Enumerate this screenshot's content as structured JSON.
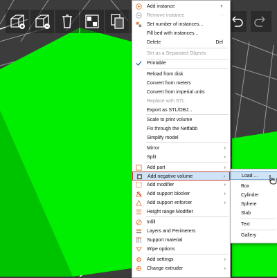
{
  "context_menu": {
    "items": [
      {
        "label": "Add instance",
        "shortcut": "+",
        "icon": "plus-circle-icon",
        "disabled": false
      },
      {
        "label": "Remove instance",
        "shortcut": "-",
        "icon": "minus-circle-icon",
        "disabled": true
      },
      {
        "label": "Set number of instances...",
        "icon": "instances-icon",
        "disabled": false
      },
      {
        "label": "Fill bed with instances...",
        "disabled": false
      },
      {
        "label": "Delete",
        "shortcut": "Del",
        "disabled": false
      },
      {
        "label": "Set as a Separated Objects",
        "disabled": true
      },
      {
        "label": "Printable",
        "checked": true,
        "disabled": false
      },
      {
        "label": "Reload from disk",
        "disabled": false
      },
      {
        "label": "Convert from meters",
        "disabled": false
      },
      {
        "label": "Convert from imperial units",
        "disabled": false
      },
      {
        "label": "Replace with STL",
        "disabled": true
      },
      {
        "label": "Export as STL/OBJ...",
        "disabled": false
      },
      {
        "label": "Scale to print volume",
        "disabled": false
      },
      {
        "label": "Fix through the Netfabb",
        "disabled": false
      },
      {
        "label": "Simplify model",
        "disabled": false
      },
      {
        "label": "Mirror",
        "submenu": true
      },
      {
        "label": "Split",
        "submenu": true
      },
      {
        "label": "Add part",
        "submenu": true,
        "icon": "add-part-icon"
      },
      {
        "label": "Add negative volume",
        "submenu": true,
        "icon": "negative-volume-icon",
        "highlighted": true
      },
      {
        "label": "Add modifier",
        "submenu": true,
        "icon": "modifier-icon"
      },
      {
        "label": "Add support blocker",
        "submenu": true,
        "icon": "support-blocker-icon"
      },
      {
        "label": "Add support enforcer",
        "submenu": true,
        "icon": "support-enforcer-icon"
      },
      {
        "label": "Height range Modifier",
        "icon": "height-range-icon"
      },
      {
        "label": "Infill",
        "icon": "infill-icon"
      },
      {
        "label": "Layers and Perimeters",
        "icon": "layers-icon"
      },
      {
        "label": "Support material",
        "icon": "support-material-icon"
      },
      {
        "label": "Wipe options",
        "icon": "wipe-icon"
      },
      {
        "label": "Add settings",
        "submenu": true,
        "icon": "settings-icon"
      },
      {
        "label": "Change extruder",
        "submenu": true,
        "icon": "extruder-icon"
      }
    ]
  },
  "submenu": {
    "items": [
      {
        "label": "Load ...",
        "highlighted": true
      },
      {
        "label": "Box"
      },
      {
        "label": "Cylinder"
      },
      {
        "label": "Sphere"
      },
      {
        "label": "Slab"
      },
      {
        "label": "Text"
      },
      {
        "label": "Gallery"
      }
    ]
  },
  "toolbar": {
    "buttons": [
      "add-object-icon",
      "delete-icon",
      "delete-all-icon",
      "arrange-icon",
      "copy-icon",
      "paste-icon",
      "variable-layer-icon"
    ],
    "right_buttons": [
      "undo-icon",
      "redo-icon"
    ]
  },
  "colors": {
    "object_top": "#00ee00",
    "object_side": "#00c300",
    "bed": "#3c3c3c",
    "menu_highlight": "#cfe3f7",
    "highlight_border": "#c0392b",
    "accent_orange": "#e07b39"
  }
}
